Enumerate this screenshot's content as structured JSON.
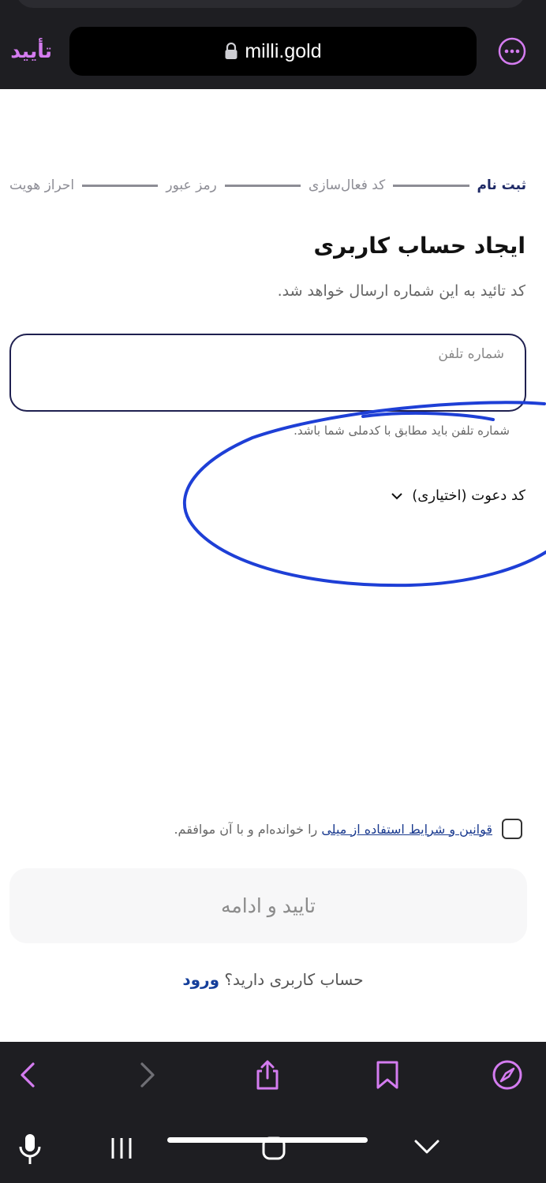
{
  "browser": {
    "confirm_label": "تأیید",
    "url": "milli.gold",
    "icons": [
      "lock-icon",
      "more-icon",
      "back-icon",
      "forward-icon",
      "share-icon",
      "bookmark-icon",
      "compass-icon"
    ]
  },
  "steps": [
    "ثبت نام",
    "کد فعال‌سازی",
    "رمز عبور",
    "احراز هویت"
  ],
  "form": {
    "title": "ایجاد حساب کاربری",
    "subtitle": "کد تائید به این شماره ارسال خواهد شد.",
    "phone_label": "شماره تلفن",
    "phone_value": "",
    "phone_hint": "شماره تلفن باید مطابق با کدملی شما باشد.",
    "invite_label": "کد دعوت (اختیاری)"
  },
  "terms": {
    "link_text": "قوانین و شرایط استفاده از میلی",
    "suffix": " را خوانده‌ام و با آن موافقم."
  },
  "submit_label": "تایید و ادامه",
  "login": {
    "question": "حساب کاربری دارید؟ ",
    "link": "ورود"
  },
  "colors": {
    "accent_purple": "#d47cf0",
    "primary_dark": "#1f2050",
    "link_blue": "#153f9b",
    "annotation_blue": "#1e3fd6"
  }
}
